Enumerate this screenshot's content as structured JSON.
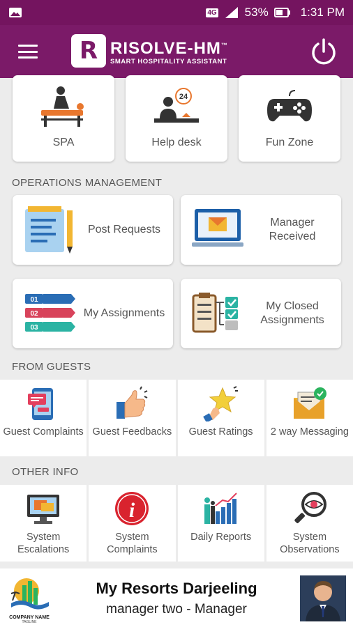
{
  "status_bar": {
    "network": "4G",
    "battery": "53%",
    "time": "1:31 PM"
  },
  "app_bar": {
    "logo_letter": "R",
    "title": "RISOLVE-HM",
    "subtitle": "SMART HOSPITALITY ASSISTANT",
    "trademark": "™"
  },
  "top_cards": [
    {
      "label": "SPA",
      "icon": "spa-icon"
    },
    {
      "label": "Help desk",
      "icon": "help-desk-icon"
    },
    {
      "label": "Fun Zone",
      "icon": "gamepad-icon"
    }
  ],
  "operations": {
    "title": "OPERATIONS MANAGEMENT",
    "items": [
      {
        "label": "Post Requests",
        "icon": "notepad-icon"
      },
      {
        "label": "Manager Received",
        "icon": "monitor-mail-icon"
      },
      {
        "label": "My Assignments",
        "icon": "numbered-list-icon"
      },
      {
        "label": "My Closed Assignments",
        "icon": "checklist-icon"
      }
    ]
  },
  "guests": {
    "title": "FROM GUESTS",
    "items": [
      {
        "label": "Guest Complaints",
        "icon": "phone-complaint-icon"
      },
      {
        "label": "Guest Feedbacks",
        "icon": "thumbs-up-icon"
      },
      {
        "label": "Guest Ratings",
        "icon": "star-hand-icon"
      },
      {
        "label": "2 way Messaging",
        "icon": "envelope-check-icon"
      }
    ]
  },
  "other_info": {
    "title": "OTHER INFO",
    "items": [
      {
        "label": "System Escalations",
        "icon": "computer-escalation-icon"
      },
      {
        "label": "System Complaints",
        "icon": "info-circle-icon"
      },
      {
        "label": "Daily Reports",
        "icon": "bar-chart-people-icon"
      },
      {
        "label": "System Observations",
        "icon": "magnifier-eye-icon"
      }
    ]
  },
  "footer": {
    "company_logo_text": "COMPANY NAME",
    "company_tagline": "TAGLINE",
    "resort_name": "My Resorts Darjeeling",
    "user_role": "manager two - Manager"
  },
  "colors": {
    "brand": "#7b1a68",
    "status_bar": "#74145f",
    "background": "#ececec"
  }
}
